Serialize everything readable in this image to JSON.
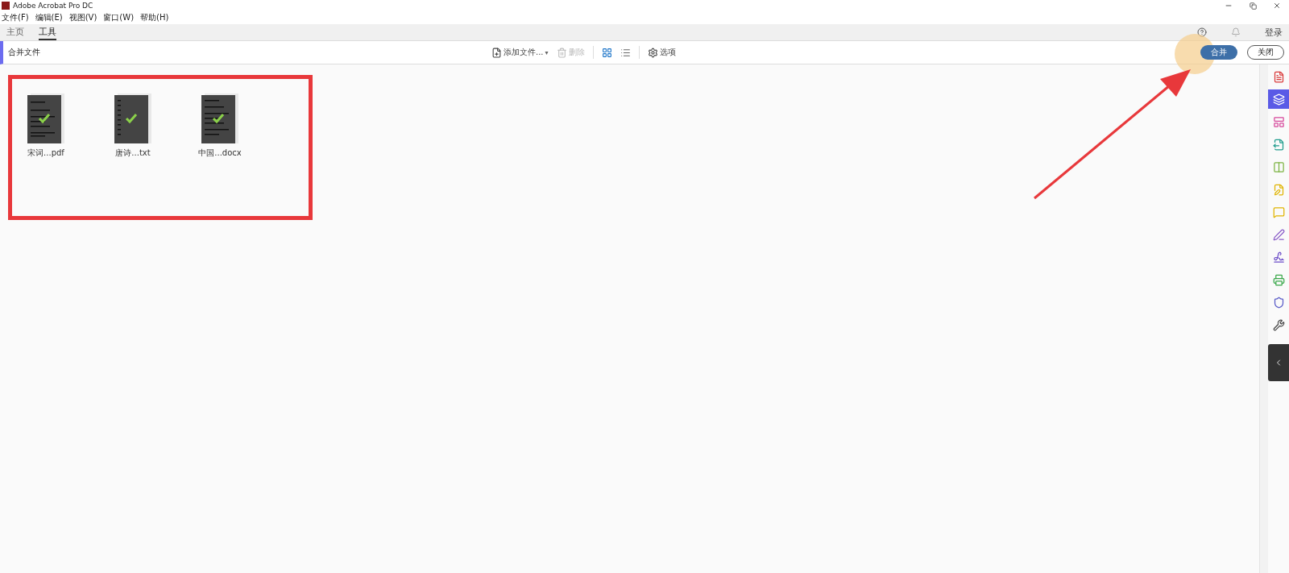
{
  "window": {
    "title": "Adobe Acrobat Pro DC"
  },
  "menu": [
    "文件(F)",
    "编辑(E)",
    "视图(V)",
    "窗口(W)",
    "帮助(H)"
  ],
  "tabs": [
    {
      "label": "主页",
      "selected": false
    },
    {
      "label": "工具",
      "selected": true
    }
  ],
  "account": {
    "login": "登录"
  },
  "tool": {
    "title": "合并文件",
    "add_files": "添加文件...",
    "add_files_caret": "▾",
    "delete": {
      "label": "删除",
      "disabled": true
    },
    "views": [
      {
        "kind": "grid",
        "selected": true
      },
      {
        "kind": "list",
        "selected": false
      }
    ],
    "options": "选项",
    "merge": "合并",
    "close": "关闭"
  },
  "files": [
    {
      "name": "宋词...pdf",
      "kind": "pdf"
    },
    {
      "name": "唐诗...txt",
      "kind": "txt"
    },
    {
      "name": "中国...docx",
      "kind": "docx"
    }
  ],
  "sidebar": [
    {
      "kind": "pdf",
      "selected": false
    },
    {
      "kind": "combine",
      "selected": true
    },
    {
      "kind": "organize",
      "selected": false
    },
    {
      "kind": "export",
      "selected": false
    },
    {
      "kind": "compare",
      "selected": false
    },
    {
      "kind": "edit",
      "selected": false
    },
    {
      "kind": "comment",
      "selected": false
    },
    {
      "kind": "fill",
      "selected": false
    },
    {
      "kind": "sign",
      "selected": false
    },
    {
      "kind": "print",
      "selected": false
    },
    {
      "kind": "protect",
      "selected": false
    },
    {
      "kind": "tools",
      "selected": false
    }
  ]
}
